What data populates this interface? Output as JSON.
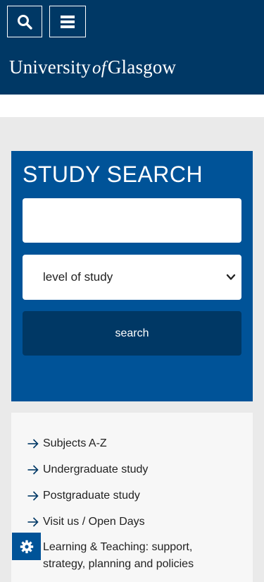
{
  "header": {
    "search_icon": "search-icon",
    "menu_icon": "hamburger-menu-icon",
    "brand_part1": "University",
    "brand_of": "of",
    "brand_part2": "Glasgow",
    "bg_color": "#003865"
  },
  "study_search": {
    "title": "STUDY SEARCH",
    "input_value": "",
    "input_placeholder": "",
    "level_select_value": "level of study",
    "search_button_label": "search",
    "panel_color": "#005398",
    "button_color": "#003865"
  },
  "links": [
    {
      "label": "Subjects A-Z"
    },
    {
      "label": "Undergraduate study"
    },
    {
      "label": "Postgraduate study"
    },
    {
      "label": "Visit us / Open Days"
    },
    {
      "label": "Learning & Teaching: support, strategy, planning and policies"
    }
  ],
  "settings": {
    "icon": "gear-icon"
  }
}
